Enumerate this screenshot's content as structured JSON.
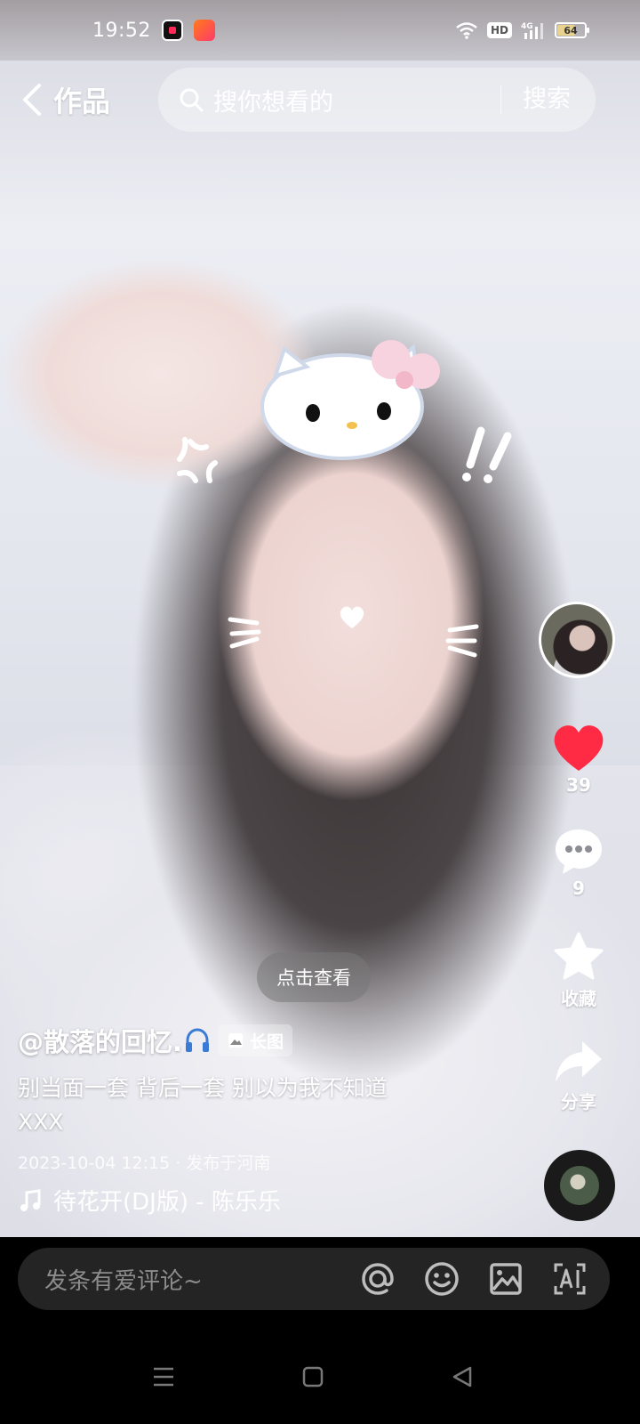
{
  "status_bar": {
    "time": "19:52",
    "battery": "64",
    "battery_level": 0.64,
    "network": "4G",
    "hd": "HD",
    "icons": [
      "screen-record-icon",
      "kuaishou-app-icon",
      "wifi-icon",
      "hd-icon",
      "signal-icon",
      "battery-icon"
    ]
  },
  "top_nav": {
    "title": "作品",
    "search_placeholder": "搜你想看的",
    "search_button": "搜索"
  },
  "actions": {
    "like_count": "39",
    "comment_count": "9",
    "favorite_label": "收藏",
    "share_label": "分享",
    "like_color": "#ff2b45"
  },
  "post": {
    "hint": "点击查看",
    "author": "@散落的回忆.",
    "tag": "长图",
    "description_line1": "别当面一套 背后一套 别以为我不知道",
    "description_line2": "XXX",
    "meta": "2023-10-04 12:15 · 发布于河南",
    "music": "待花开(DJ版) - 陈乐乐"
  },
  "comment_bar": {
    "placeholder": "发条有爱评论~",
    "buttons": [
      "at-icon",
      "emoji-icon",
      "image-icon",
      "ai-icon"
    ]
  },
  "nav_bar": {
    "buttons": [
      "menu-icon",
      "home-icon",
      "back-triangle-icon"
    ]
  }
}
